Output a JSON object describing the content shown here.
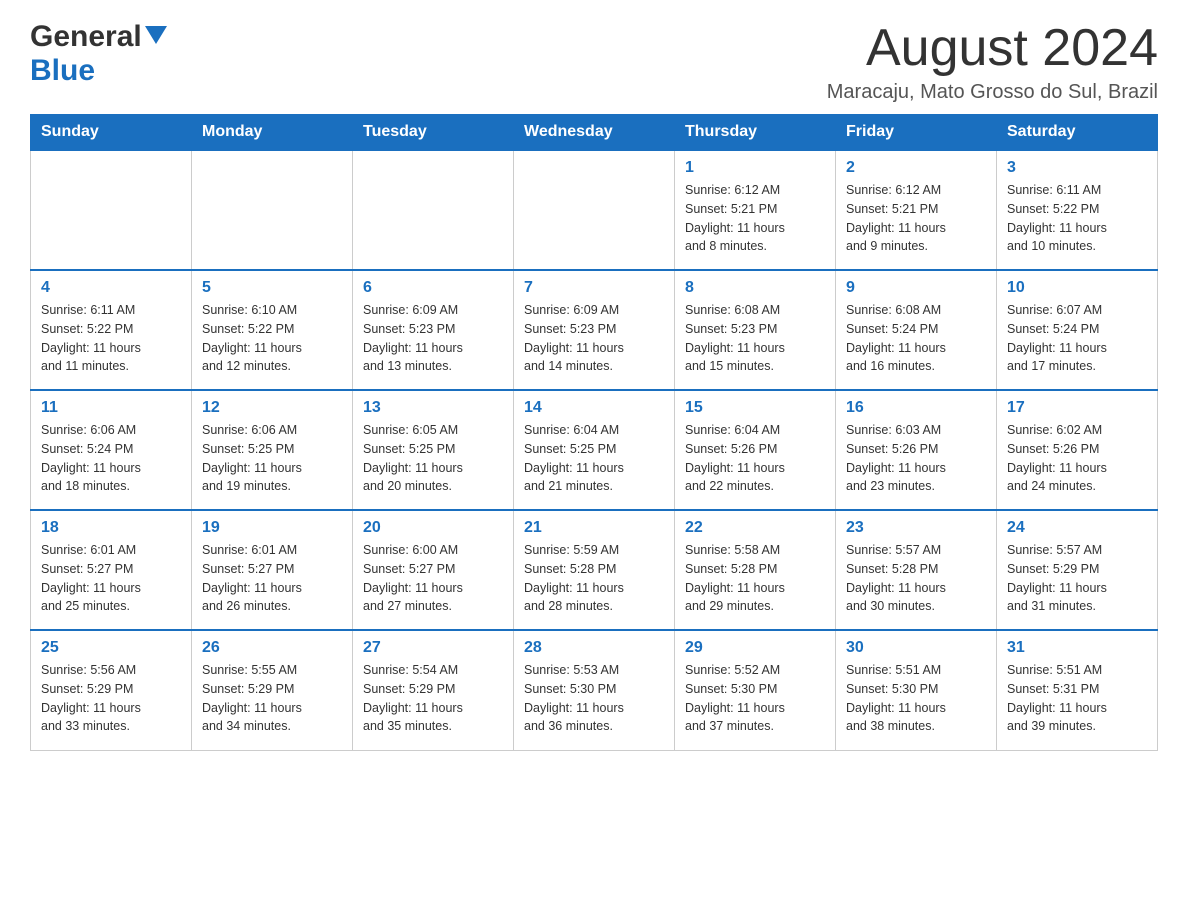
{
  "header": {
    "logo_general": "General",
    "logo_blue": "Blue",
    "month_title": "August 2024",
    "location": "Maracaju, Mato Grosso do Sul, Brazil"
  },
  "calendar": {
    "days_of_week": [
      "Sunday",
      "Monday",
      "Tuesday",
      "Wednesday",
      "Thursday",
      "Friday",
      "Saturday"
    ],
    "weeks": [
      [
        {
          "day": "",
          "info": ""
        },
        {
          "day": "",
          "info": ""
        },
        {
          "day": "",
          "info": ""
        },
        {
          "day": "",
          "info": ""
        },
        {
          "day": "1",
          "info": "Sunrise: 6:12 AM\nSunset: 5:21 PM\nDaylight: 11 hours\nand 8 minutes."
        },
        {
          "day": "2",
          "info": "Sunrise: 6:12 AM\nSunset: 5:21 PM\nDaylight: 11 hours\nand 9 minutes."
        },
        {
          "day": "3",
          "info": "Sunrise: 6:11 AM\nSunset: 5:22 PM\nDaylight: 11 hours\nand 10 minutes."
        }
      ],
      [
        {
          "day": "4",
          "info": "Sunrise: 6:11 AM\nSunset: 5:22 PM\nDaylight: 11 hours\nand 11 minutes."
        },
        {
          "day": "5",
          "info": "Sunrise: 6:10 AM\nSunset: 5:22 PM\nDaylight: 11 hours\nand 12 minutes."
        },
        {
          "day": "6",
          "info": "Sunrise: 6:09 AM\nSunset: 5:23 PM\nDaylight: 11 hours\nand 13 minutes."
        },
        {
          "day": "7",
          "info": "Sunrise: 6:09 AM\nSunset: 5:23 PM\nDaylight: 11 hours\nand 14 minutes."
        },
        {
          "day": "8",
          "info": "Sunrise: 6:08 AM\nSunset: 5:23 PM\nDaylight: 11 hours\nand 15 minutes."
        },
        {
          "day": "9",
          "info": "Sunrise: 6:08 AM\nSunset: 5:24 PM\nDaylight: 11 hours\nand 16 minutes."
        },
        {
          "day": "10",
          "info": "Sunrise: 6:07 AM\nSunset: 5:24 PM\nDaylight: 11 hours\nand 17 minutes."
        }
      ],
      [
        {
          "day": "11",
          "info": "Sunrise: 6:06 AM\nSunset: 5:24 PM\nDaylight: 11 hours\nand 18 minutes."
        },
        {
          "day": "12",
          "info": "Sunrise: 6:06 AM\nSunset: 5:25 PM\nDaylight: 11 hours\nand 19 minutes."
        },
        {
          "day": "13",
          "info": "Sunrise: 6:05 AM\nSunset: 5:25 PM\nDaylight: 11 hours\nand 20 minutes."
        },
        {
          "day": "14",
          "info": "Sunrise: 6:04 AM\nSunset: 5:25 PM\nDaylight: 11 hours\nand 21 minutes."
        },
        {
          "day": "15",
          "info": "Sunrise: 6:04 AM\nSunset: 5:26 PM\nDaylight: 11 hours\nand 22 minutes."
        },
        {
          "day": "16",
          "info": "Sunrise: 6:03 AM\nSunset: 5:26 PM\nDaylight: 11 hours\nand 23 minutes."
        },
        {
          "day": "17",
          "info": "Sunrise: 6:02 AM\nSunset: 5:26 PM\nDaylight: 11 hours\nand 24 minutes."
        }
      ],
      [
        {
          "day": "18",
          "info": "Sunrise: 6:01 AM\nSunset: 5:27 PM\nDaylight: 11 hours\nand 25 minutes."
        },
        {
          "day": "19",
          "info": "Sunrise: 6:01 AM\nSunset: 5:27 PM\nDaylight: 11 hours\nand 26 minutes."
        },
        {
          "day": "20",
          "info": "Sunrise: 6:00 AM\nSunset: 5:27 PM\nDaylight: 11 hours\nand 27 minutes."
        },
        {
          "day": "21",
          "info": "Sunrise: 5:59 AM\nSunset: 5:28 PM\nDaylight: 11 hours\nand 28 minutes."
        },
        {
          "day": "22",
          "info": "Sunrise: 5:58 AM\nSunset: 5:28 PM\nDaylight: 11 hours\nand 29 minutes."
        },
        {
          "day": "23",
          "info": "Sunrise: 5:57 AM\nSunset: 5:28 PM\nDaylight: 11 hours\nand 30 minutes."
        },
        {
          "day": "24",
          "info": "Sunrise: 5:57 AM\nSunset: 5:29 PM\nDaylight: 11 hours\nand 31 minutes."
        }
      ],
      [
        {
          "day": "25",
          "info": "Sunrise: 5:56 AM\nSunset: 5:29 PM\nDaylight: 11 hours\nand 33 minutes."
        },
        {
          "day": "26",
          "info": "Sunrise: 5:55 AM\nSunset: 5:29 PM\nDaylight: 11 hours\nand 34 minutes."
        },
        {
          "day": "27",
          "info": "Sunrise: 5:54 AM\nSunset: 5:29 PM\nDaylight: 11 hours\nand 35 minutes."
        },
        {
          "day": "28",
          "info": "Sunrise: 5:53 AM\nSunset: 5:30 PM\nDaylight: 11 hours\nand 36 minutes."
        },
        {
          "day": "29",
          "info": "Sunrise: 5:52 AM\nSunset: 5:30 PM\nDaylight: 11 hours\nand 37 minutes."
        },
        {
          "day": "30",
          "info": "Sunrise: 5:51 AM\nSunset: 5:30 PM\nDaylight: 11 hours\nand 38 minutes."
        },
        {
          "day": "31",
          "info": "Sunrise: 5:51 AM\nSunset: 5:31 PM\nDaylight: 11 hours\nand 39 minutes."
        }
      ]
    ]
  }
}
